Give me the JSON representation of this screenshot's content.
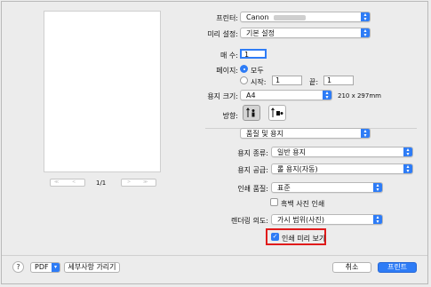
{
  "printer": {
    "label": "프린터:",
    "value": "Canon"
  },
  "presets": {
    "label": "미리 설정:",
    "value": "기본 설정"
  },
  "copies": {
    "label": "매 수:",
    "value": "1"
  },
  "pages": {
    "label": "페이지:",
    "all_label": "모두",
    "from_label": "시작:",
    "from_value": "1",
    "to_label": "끝:",
    "to_value": "1"
  },
  "paper_size": {
    "label": "용지 크기:",
    "value": "A4",
    "dims": "210 x 297mm"
  },
  "orientation": {
    "label": "방향:"
  },
  "section": {
    "value": "품질 및 용지"
  },
  "media_type": {
    "label": "용지 종류:",
    "value": "일반 용지"
  },
  "paper_source": {
    "label": "용지 공급:",
    "value": "롤 용지(자동)"
  },
  "print_quality": {
    "label": "인쇄 품질:",
    "value": "표준"
  },
  "grayscale": {
    "label": "흑백 사진 인쇄",
    "checked": false
  },
  "rendering_intent": {
    "label": "렌더링 의도:",
    "value": "가시 범위(사진)"
  },
  "print_preview": {
    "label": "인쇄 미리 보기",
    "checked": true
  },
  "pager": {
    "page_text": "1/1"
  },
  "footer": {
    "help": "?",
    "pdf": "PDF",
    "hide_details": "세부사항 가리기",
    "cancel": "취소",
    "print": "프린트"
  },
  "colors": {
    "accent": "#2e7cf6",
    "highlight": "#e01b1b"
  }
}
